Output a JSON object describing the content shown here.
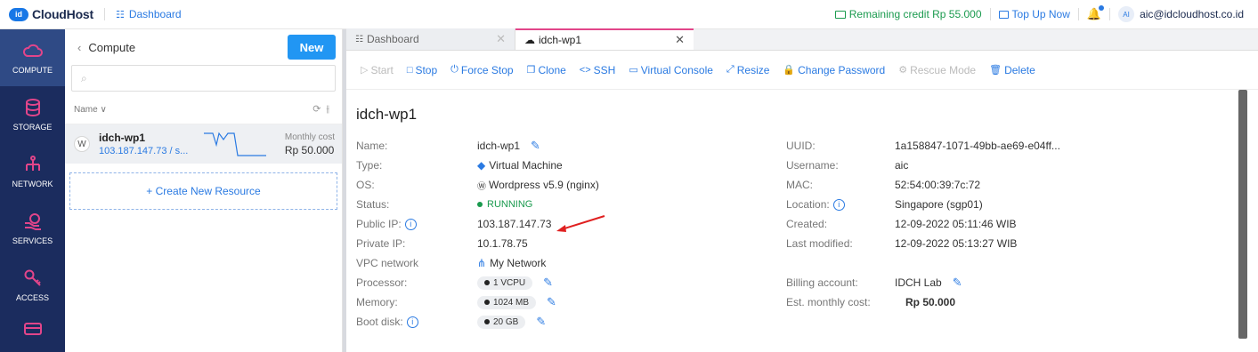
{
  "topbar": {
    "logo_badge": "id",
    "logo_text": "CloudHost",
    "dashboard_link": "Dashboard",
    "credit": "Remaining credit Rp 55.000",
    "topup": "Top Up Now",
    "avatar_initials": "AI",
    "email": "aic@idcloudhost.co.id"
  },
  "leftnav": {
    "items": [
      {
        "label": "COMPUTE",
        "icon": "cloud-icon",
        "active": true
      },
      {
        "label": "STORAGE",
        "icon": "database-icon"
      },
      {
        "label": "NETWORK",
        "icon": "network-icon"
      },
      {
        "label": "SERVICES",
        "icon": "services-icon"
      },
      {
        "label": "ACCESS",
        "icon": "key-icon"
      },
      {
        "label": "",
        "icon": "billing-card-icon"
      }
    ]
  },
  "listpanel": {
    "back_title": "Compute",
    "new_button": "New",
    "search_placeholder": "",
    "sort_label": "Name",
    "resource": {
      "name": "idch-wp1",
      "ip": "103.187.147.73 / s...",
      "cost_label": "Monthly cost",
      "cost_value": "Rp 50.000"
    },
    "create_label": "+ Create New Resource"
  },
  "tabs": [
    {
      "label": "Dashboard",
      "icon": "grid-icon"
    },
    {
      "label": "idch-wp1",
      "icon": "cloud-icon"
    }
  ],
  "toolbar": {
    "start": "Start",
    "stop": "Stop",
    "force_stop": "Force Stop",
    "clone": "Clone",
    "ssh": "SSH",
    "console": "Virtual Console",
    "resize": "Resize",
    "change_password": "Change Password",
    "rescue": "Rescue Mode",
    "delete": "Delete"
  },
  "detail": {
    "title": "idch-wp1",
    "left": {
      "name_label": "Name:",
      "name": "idch-wp1",
      "type_label": "Type:",
      "type": "Virtual Machine",
      "os_label": "OS:",
      "os": "Wordpress v5.9 (nginx)",
      "status_label": "Status:",
      "status": "RUNNING",
      "public_ip_label": "Public IP:",
      "public_ip": "103.187.147.73",
      "private_ip_label": "Private IP:",
      "private_ip": "10.1.78.75",
      "vpc_label": "VPC network",
      "vpc": "My Network",
      "processor_label": "Processor:",
      "processor": "1 VCPU",
      "memory_label": "Memory:",
      "memory": "1024 MB",
      "boot_label": "Boot disk:",
      "boot": "20 GB"
    },
    "right": {
      "uuid_label": "UUID:",
      "uuid": "1a158847-1071-49bb-ae69-e04ff...",
      "username_label": "Username:",
      "username": "aic",
      "mac_label": "MAC:",
      "mac": "52:54:00:39:7c:72",
      "location_label": "Location:",
      "location": "Singapore (sgp01)",
      "created_label": "Created:",
      "created": "12-09-2022 05:11:46 WIB",
      "modified_label": "Last modified:",
      "modified": "12-09-2022 05:13:27 WIB",
      "billing_label": "Billing account:",
      "billing": "IDCH Lab",
      "monthly_label": "Est. monthly cost:",
      "monthly": "Rp 50.000"
    }
  }
}
